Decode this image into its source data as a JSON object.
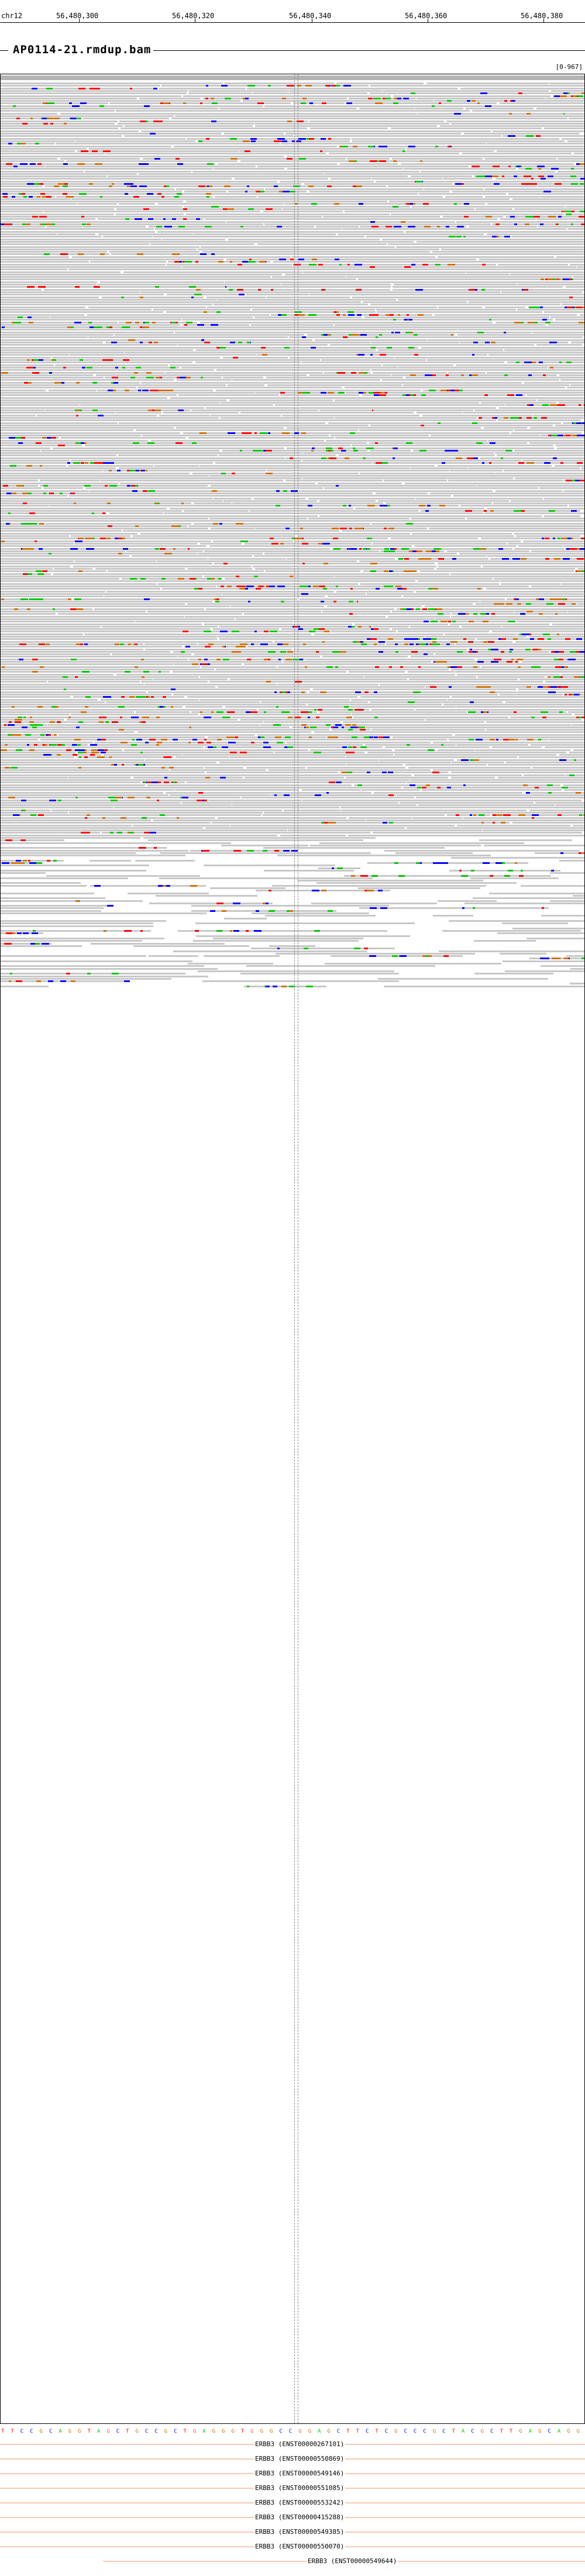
{
  "ruler": {
    "chromosome": "chr12",
    "positions": [
      "56,480,300",
      "56,480,320",
      "56,480,340",
      "56,480,360",
      "56,480,380"
    ]
  },
  "track": {
    "title": "AP0114-21.rmdup.bam",
    "coverage_scale": "[0-967]"
  },
  "colors": {
    "read": "#c8c8c8",
    "base_A": "#00c800",
    "base_C": "#0000ff",
    "base_G": "#d17105",
    "base_T": "#ff0000",
    "insertion": "#800080",
    "transcript": "#f8c8b0"
  },
  "sequence": "TTCCGCAGGTAGCTGCCGCTGAGGGTGGGCCGGAGCTTCTCGCCCGCTACGCTTGAGCAGG",
  "transcripts": [
    {
      "label": "ERBB3 (ENST00000267101)"
    },
    {
      "label": "ERBB3 (ENST00000550869)"
    },
    {
      "label": "ERBB3 (ENST00000549146)"
    },
    {
      "label": "ERBB3 (ENST00000551085)"
    },
    {
      "label": "ERBB3 (ENST00000553242)"
    },
    {
      "label": "ERBB3 (ENST00000415288)"
    },
    {
      "label": "ERBB3 (ENST00000549385)"
    },
    {
      "label": "ERBB3 (ENST00000550070)"
    },
    {
      "label": "ERBB3 (ENST00000549644)"
    }
  ]
}
